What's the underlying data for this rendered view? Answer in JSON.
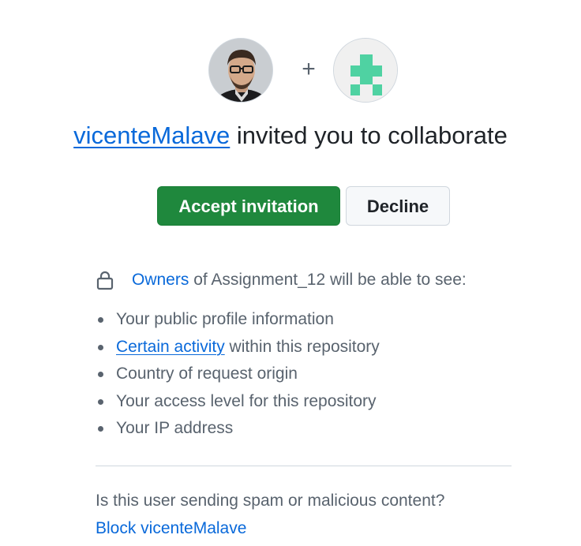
{
  "inviter": {
    "username": "vicenteMalave"
  },
  "headline": {
    "rest": " invited you to collaborate"
  },
  "avatars": {
    "user_icon": "user-photo-avatar",
    "separator": "+",
    "repo_icon": "identicon-avatar",
    "identicon_color": "#4fd2a2"
  },
  "actions": {
    "accept_label": "Accept invitation",
    "decline_label": "Decline"
  },
  "visibility": {
    "lock_icon": "lock-icon",
    "owners_link": "Owners",
    "text": " of Assignment_12 will be able to see:"
  },
  "details": [
    {
      "text": "Your public profile information"
    },
    {
      "link": "Certain activity",
      "text": " within this repository"
    },
    {
      "text": "Country of request origin"
    },
    {
      "text": "Your access level for this repository"
    },
    {
      "text": "Your IP address"
    }
  ],
  "report": {
    "question": "Is this user sending spam or malicious content?",
    "block_link": "Block vicenteMalave"
  },
  "colors": {
    "accent_link": "#0969da",
    "accept_green": "#1f883d",
    "muted_text": "#59636e"
  }
}
